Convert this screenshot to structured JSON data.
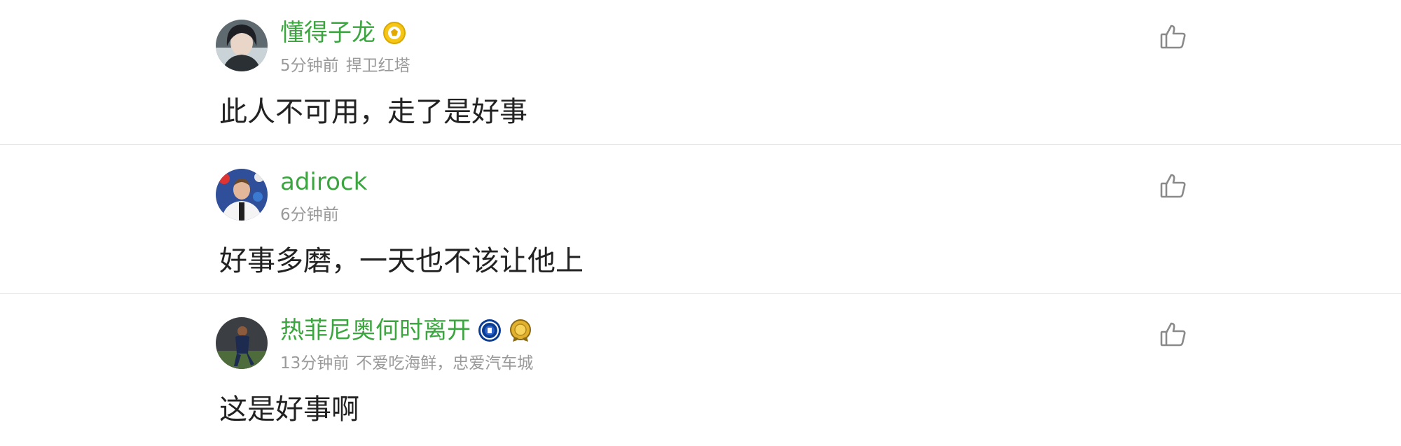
{
  "comments": [
    {
      "username": "懂得子龙",
      "time": "5分钟前",
      "signature": "捍卫红塔",
      "text": "此人不可用，走了是好事",
      "avatar": "avatar-dark-hair",
      "badges": [
        "gold-football-badge-icon"
      ]
    },
    {
      "username": "adirock",
      "time": "6分钟前",
      "signature": "",
      "text": "好事多磨，一天也不该让他上",
      "avatar": "avatar-press-conference",
      "badges": []
    },
    {
      "username": "热菲尼奥何时离开",
      "time": "13分钟前",
      "signature": "不爱吃海鲜，忠爱汽车城",
      "text": "这是好事啊",
      "avatar": "avatar-player",
      "badges": [
        "chelsea-crest-icon",
        "gold-medal-icon"
      ]
    }
  ],
  "colors": {
    "username": "#3ba53f",
    "meta": "#9a9a9a",
    "text": "#222222",
    "divider": "#e6e6e6",
    "like_icon": "#8a8a8a"
  }
}
